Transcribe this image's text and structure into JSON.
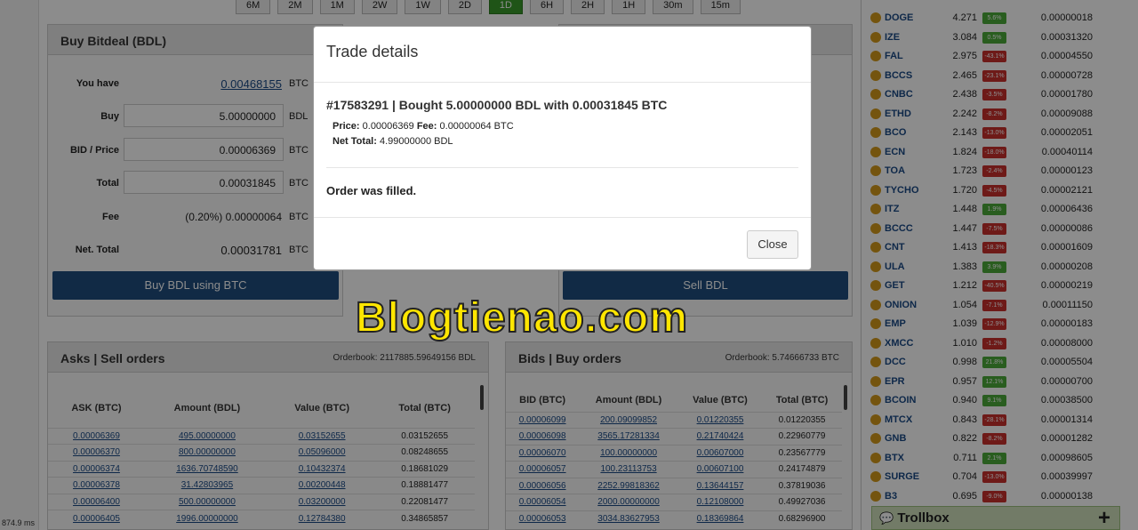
{
  "timeframes": [
    "6M",
    "2M",
    "1M",
    "2W",
    "1W",
    "2D",
    "1D",
    "6H",
    "2H",
    "1H",
    "30m",
    "15m"
  ],
  "active_timeframe": "1D",
  "buy_panel": {
    "title": "Buy Bitdeal (BDL)",
    "rows": [
      {
        "label": "You have",
        "value": "0.00468155",
        "currency": "BTC",
        "kind": "link"
      },
      {
        "label": "Buy",
        "value": "5.00000000",
        "currency": "BDL",
        "kind": "input"
      },
      {
        "label": "BID / Price",
        "value": "0.00006369",
        "currency": "BTC",
        "kind": "input"
      },
      {
        "label": "Total",
        "value": "0.00031845",
        "currency": "BTC",
        "kind": "input"
      },
      {
        "label": "Fee",
        "value": "(0.20%) 0.00000064",
        "currency": "BTC",
        "kind": "text"
      },
      {
        "label": "Net. Total",
        "value": "0.00031781",
        "currency": "BTC",
        "kind": "text"
      }
    ],
    "button": "Buy BDL using BTC"
  },
  "sell_panel": {
    "button": "Sell BDL"
  },
  "asks": {
    "title": "Asks | Sell orders",
    "orderbook": "Orderbook: 2117885.59649156 BDL",
    "headers": [
      "ASK (BTC)",
      "Amount (BDL)",
      "Value (BTC)",
      "Total (BTC)"
    ],
    "rows": [
      [
        "0.00006369",
        "495.00000000",
        "0.03152655",
        "0.03152655"
      ],
      [
        "0.00006370",
        "800.00000000",
        "0.05096000",
        "0.08248655"
      ],
      [
        "0.00006374",
        "1636.70748590",
        "0.10432374",
        "0.18681029"
      ],
      [
        "0.00006378",
        "31.42803965",
        "0.00200448",
        "0.18881477"
      ],
      [
        "0.00006400",
        "500.00000000",
        "0.03200000",
        "0.22081477"
      ],
      [
        "0.00006405",
        "1996.00000000",
        "0.12784380",
        "0.34865857"
      ]
    ]
  },
  "bids": {
    "title": "Bids | Buy orders",
    "orderbook": "Orderbook: 5.74666733 BTC",
    "headers": [
      "BID (BTC)",
      "Amount (BDL)",
      "Value (BTC)",
      "Total (BTC)"
    ],
    "rows": [
      [
        "0.00006099",
        "200.09099852",
        "0.01220355",
        "0.01220355"
      ],
      [
        "0.00006098",
        "3565.17281334",
        "0.21740424",
        "0.22960779"
      ],
      [
        "0.00006070",
        "100.00000000",
        "0.00607000",
        "0.23567779"
      ],
      [
        "0.00006057",
        "100.23113753",
        "0.00607100",
        "0.24174879"
      ],
      [
        "0.00006056",
        "2252.99818362",
        "0.13644157",
        "0.37819036"
      ],
      [
        "0.00006054",
        "2000.00000000",
        "0.12108000",
        "0.49927036"
      ],
      [
        "0.00006053",
        "3034.83627953",
        "0.18369864",
        "0.68296900"
      ]
    ]
  },
  "markets": [
    {
      "name": "DOGE",
      "vol": "4.271",
      "chg": "5.6%",
      "up": true,
      "price": "0.00000018"
    },
    {
      "name": "IZE",
      "vol": "3.084",
      "chg": "0.5%",
      "up": true,
      "price": "0.00031320"
    },
    {
      "name": "FAL",
      "vol": "2.975",
      "chg": "-43.1%",
      "up": false,
      "price": "0.00004550"
    },
    {
      "name": "BCCS",
      "vol": "2.465",
      "chg": "-23.1%",
      "up": false,
      "price": "0.00000728"
    },
    {
      "name": "CNBC",
      "vol": "2.438",
      "chg": "-3.5%",
      "up": false,
      "price": "0.00001780"
    },
    {
      "name": "ETHD",
      "vol": "2.242",
      "chg": "-8.2%",
      "up": false,
      "price": "0.00009088"
    },
    {
      "name": "BCO",
      "vol": "2.143",
      "chg": "-13.0%",
      "up": false,
      "price": "0.00002051"
    },
    {
      "name": "ECN",
      "vol": "1.824",
      "chg": "-18.0%",
      "up": false,
      "price": "0.00040114"
    },
    {
      "name": "TOA",
      "vol": "1.723",
      "chg": "-2.4%",
      "up": false,
      "price": "0.00000123"
    },
    {
      "name": "TYCHO",
      "vol": "1.720",
      "chg": "-4.5%",
      "up": false,
      "price": "0.00002121"
    },
    {
      "name": "ITZ",
      "vol": "1.448",
      "chg": "1.9%",
      "up": true,
      "price": "0.00006436"
    },
    {
      "name": "BCCC",
      "vol": "1.447",
      "chg": "-7.5%",
      "up": false,
      "price": "0.00000086"
    },
    {
      "name": "CNT",
      "vol": "1.413",
      "chg": "-18.3%",
      "up": false,
      "price": "0.00001609"
    },
    {
      "name": "ULA",
      "vol": "1.383",
      "chg": "3.9%",
      "up": true,
      "price": "0.00000208"
    },
    {
      "name": "GET",
      "vol": "1.212",
      "chg": "-40.5%",
      "up": false,
      "price": "0.00000219"
    },
    {
      "name": "ONION",
      "vol": "1.054",
      "chg": "-7.1%",
      "up": false,
      "price": "0.00011150"
    },
    {
      "name": "EMP",
      "vol": "1.039",
      "chg": "-12.9%",
      "up": false,
      "price": "0.00000183"
    },
    {
      "name": "XMCC",
      "vol": "1.010",
      "chg": "-1.2%",
      "up": false,
      "price": "0.00008000"
    },
    {
      "name": "DCC",
      "vol": "0.998",
      "chg": "21.8%",
      "up": true,
      "price": "0.00005504"
    },
    {
      "name": "EPR",
      "vol": "0.957",
      "chg": "12.1%",
      "up": true,
      "price": "0.00000700"
    },
    {
      "name": "BCOIN",
      "vol": "0.940",
      "chg": "9.1%",
      "up": true,
      "price": "0.00038500"
    },
    {
      "name": "MTCX",
      "vol": "0.843",
      "chg": "-28.1%",
      "up": false,
      "price": "0.00001314"
    },
    {
      "name": "GNB",
      "vol": "0.822",
      "chg": "-8.2%",
      "up": false,
      "price": "0.00001282"
    },
    {
      "name": "BTX",
      "vol": "0.711",
      "chg": "2.1%",
      "up": true,
      "price": "0.00098605"
    },
    {
      "name": "SURGE",
      "vol": "0.704",
      "chg": "-13.0%",
      "up": false,
      "price": "0.00039997"
    },
    {
      "name": "B3",
      "vol": "0.695",
      "chg": "-9.0%",
      "up": false,
      "price": "0.00000138"
    }
  ],
  "trollbox": "Trollbox",
  "load_time": "874.9 ms",
  "modal": {
    "title": "Trade details",
    "trade_line": "#17583291 | Bought 5.00000000 BDL with 0.00031845 BTC",
    "price_label": "Price:",
    "price_value": "0.00006369",
    "fee_label": "Fee:",
    "fee_value": "0.00000064 BTC",
    "net_label": "Net Total:",
    "net_value": "4.99000000 BDL",
    "status": "Order was filled.",
    "close": "Close"
  },
  "watermark": "Blogtienao.com",
  "colors": {
    "primary_button": "#1f4e7e",
    "active_tab": "#3a9a2a",
    "up": "#4caa3a",
    "down": "#c9302c",
    "link": "#1a4a86",
    "watermark": "#ffe600"
  }
}
